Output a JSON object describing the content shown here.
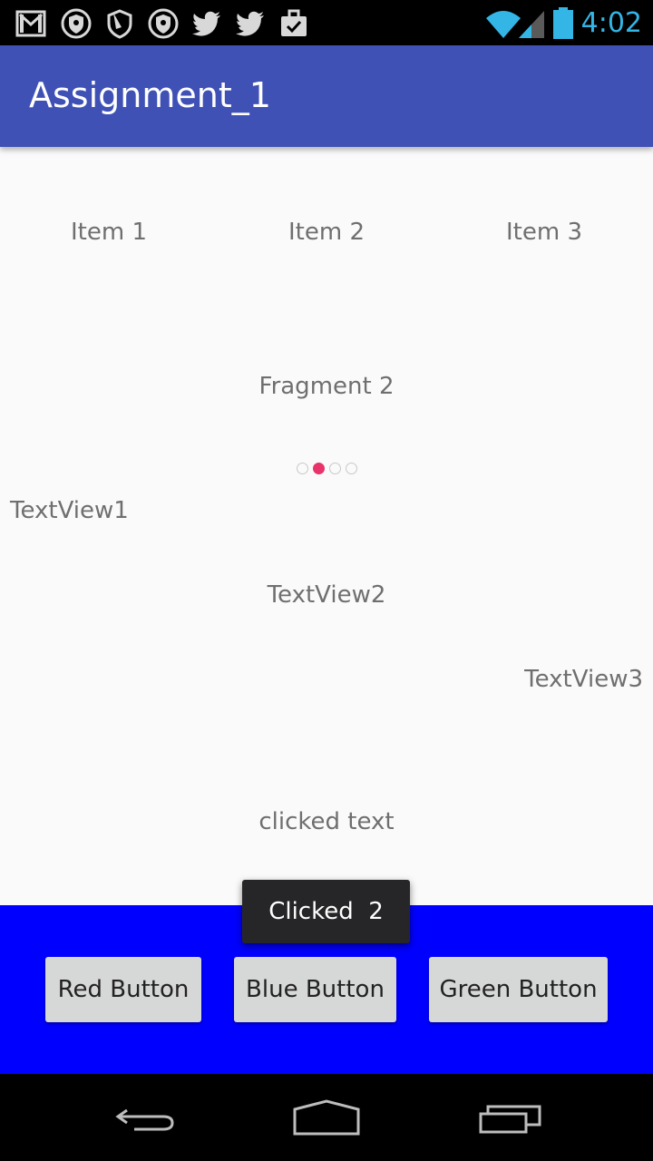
{
  "status_bar": {
    "time": "4:02",
    "left_icons": [
      "gmail-icon",
      "shield-icon",
      "shield-hand-icon",
      "shield-icon",
      "twitter-icon",
      "twitter-icon",
      "briefcase-check-icon"
    ],
    "right_icons": [
      "wifi-icon",
      "signal-icon",
      "battery-icon"
    ],
    "time_color": "#33b5e5"
  },
  "app_bar": {
    "title": "Assignment_1",
    "color": "#3f51b5"
  },
  "content": {
    "items": [
      "Item 1",
      "Item 2",
      "Item 3"
    ],
    "fragment_label": "Fragment 2",
    "page_indicator": {
      "count": 4,
      "active_index": 1,
      "active_color": "#e8336b"
    },
    "textview1": "TextView1",
    "textview2": "TextView2",
    "textview3": "TextView3",
    "clicked_text": "clicked text"
  },
  "toast": {
    "message": "Clicked  2"
  },
  "button_panel": {
    "background": "#0000ff",
    "buttons": {
      "red": "Red Button",
      "blue": "Blue Button",
      "green": "Green Button"
    }
  },
  "nav_bar": {
    "icons": [
      "back-icon",
      "home-icon",
      "recents-icon"
    ]
  }
}
